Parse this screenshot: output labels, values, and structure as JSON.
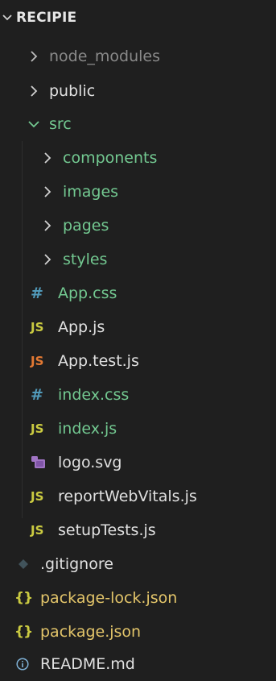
{
  "explorer": {
    "root_label": "RECIPIE",
    "colors": {
      "background": "#1f1f1f",
      "text": "#cccccc",
      "dimmed": "#8a8a8a",
      "folder_green": "#73c991",
      "js_yellow": "#cbcb41",
      "js_test_orange": "#e37933",
      "css_blue": "#519aba",
      "svg_purple": "#a074c4",
      "json_yellow": "#cbcb41",
      "info_blue": "#519aba",
      "git_gray": "#41535b"
    },
    "items": [
      {
        "label": "node_modules",
        "kind": "folder",
        "state": "collapsed",
        "depth": 1,
        "style": "dimmed"
      },
      {
        "label": "public",
        "kind": "folder",
        "state": "collapsed",
        "depth": 1,
        "style": "normal"
      },
      {
        "label": "src",
        "kind": "folder",
        "state": "expanded",
        "depth": 1,
        "style": "green"
      },
      {
        "label": "components",
        "kind": "folder",
        "state": "collapsed",
        "depth": 2,
        "style": "green"
      },
      {
        "label": "images",
        "kind": "folder",
        "state": "collapsed",
        "depth": 2,
        "style": "green"
      },
      {
        "label": "pages",
        "kind": "folder",
        "state": "collapsed",
        "depth": 2,
        "style": "green"
      },
      {
        "label": "styles",
        "kind": "folder",
        "state": "collapsed",
        "depth": 2,
        "style": "green"
      },
      {
        "label": "App.css",
        "kind": "file",
        "icon": "css-hash-icon",
        "icon_text": "#",
        "depth": 2
      },
      {
        "label": "App.js",
        "kind": "file",
        "icon": "js-icon",
        "icon_text": "JS",
        "depth": 2
      },
      {
        "label": "App.test.js",
        "kind": "file",
        "icon": "js-test-icon",
        "icon_text": "JS",
        "depth": 2
      },
      {
        "label": "index.css",
        "kind": "file",
        "icon": "css-hash-icon",
        "icon_text": "#",
        "depth": 2
      },
      {
        "label": "index.js",
        "kind": "file",
        "icon": "js-icon",
        "icon_text": "JS",
        "depth": 2
      },
      {
        "label": "logo.svg",
        "kind": "file",
        "icon": "svg-icon",
        "icon_text": "",
        "depth": 2
      },
      {
        "label": "reportWebVitals.js",
        "kind": "file",
        "icon": "js-icon",
        "icon_text": "JS",
        "depth": 2
      },
      {
        "label": "setupTests.js",
        "kind": "file",
        "icon": "js-icon",
        "icon_text": "JS",
        "depth": 2
      },
      {
        "label": ".gitignore",
        "kind": "file",
        "icon": "git-icon",
        "icon_text": "",
        "depth": 1
      },
      {
        "label": "package-lock.json",
        "kind": "file",
        "icon": "json-braces-icon",
        "icon_text": "{}",
        "depth": 1
      },
      {
        "label": "package.json",
        "kind": "file",
        "icon": "json-braces-icon",
        "icon_text": "{}",
        "depth": 1
      },
      {
        "label": "README.md",
        "kind": "file",
        "icon": "info-icon",
        "icon_text": "",
        "depth": 1
      }
    ]
  }
}
